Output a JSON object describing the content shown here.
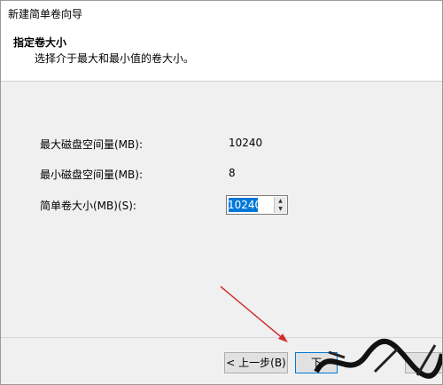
{
  "window": {
    "title": "新建简单卷向导"
  },
  "header": {
    "title": "指定卷大小",
    "subtitle": "选择介于最大和最小值的卷大小。"
  },
  "form": {
    "max_label": "最大磁盘空间量(MB):",
    "max_value": "10240",
    "min_label": "最小磁盘空间量(MB):",
    "min_value": "8",
    "size_label": "简单卷大小(MB)(S):",
    "size_value": "10240"
  },
  "footer": {
    "back_label": "< 上一步(B)",
    "next_label": "下",
    "cancel_label": ""
  },
  "colors": {
    "selection": "#0078d7",
    "annotation_arrow": "#d22d2d"
  },
  "icons": {
    "spinner_up": "caret-up-icon",
    "spinner_down": "caret-down-icon"
  }
}
